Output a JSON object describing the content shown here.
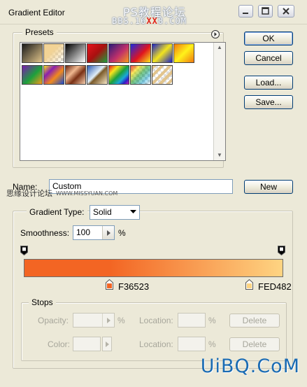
{
  "window": {
    "title": "Gradient Editor",
    "watermark_line1": "PS教程论坛",
    "watermark_line2_prefix": "BBS.16",
    "watermark_line2_red": "XX",
    "watermark_line2_suffix": "8.COM"
  },
  "presets": {
    "legend": "Presets",
    "menu_icon": "circle-arrow-icon",
    "items": [
      {
        "name": "foreground-to-background"
      },
      {
        "name": "foreground-to-transparent"
      },
      {
        "name": "black-white"
      },
      {
        "name": "red-green"
      },
      {
        "name": "violet-orange"
      },
      {
        "name": "blue-red-yellow"
      },
      {
        "name": "blue-yellow-blue"
      },
      {
        "name": "orange-yellow-orange"
      },
      {
        "name": "violet-green-orange"
      },
      {
        "name": "yellow-violet-orange-blue"
      },
      {
        "name": "copper"
      },
      {
        "name": "chrome"
      },
      {
        "name": "spectrum"
      },
      {
        "name": "transparent-rainbow"
      },
      {
        "name": "transparent-stripes"
      }
    ]
  },
  "buttons": {
    "ok": "OK",
    "cancel": "Cancel",
    "load": "Load...",
    "save": "Save...",
    "new": "New"
  },
  "name_field": {
    "label": "Name:",
    "value": "Custom"
  },
  "watermark_left": {
    "text1": "思缘设计论坛",
    "text2": "WWW.MISSYUAN.COM"
  },
  "gradient": {
    "type_label": "Gradient Type:",
    "type_value": "Solid",
    "smoothness_label": "Smoothness:",
    "smoothness_value": "100",
    "smoothness_unit": "%",
    "left_color": "#F36523",
    "right_color": "#FED482",
    "left_stop_label": "F36523",
    "right_stop_label": "FED482"
  },
  "stops": {
    "legend": "Stops",
    "opacity_label": "Opacity:",
    "opacity_unit": "%",
    "color_label": "Color:",
    "location_label": "Location:",
    "location_unit": "%",
    "delete_label": "Delete"
  },
  "watermark_bottom": "UiBQ.CoM"
}
